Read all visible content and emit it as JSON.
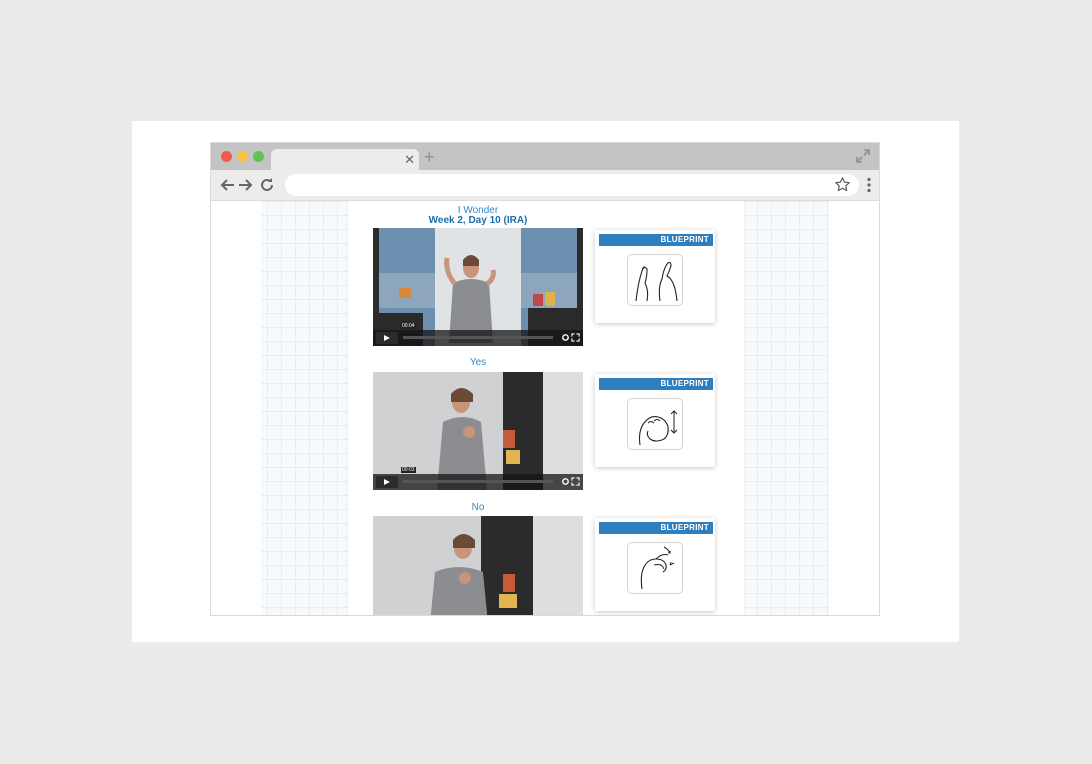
{
  "sections": [
    {
      "title": "I Wonder",
      "subtitle": "Week 2, Day 10 (IRA)",
      "video_time": "00:04",
      "card_brand": "BLUEPRINT"
    },
    {
      "title": "Yes",
      "subtitle": "",
      "video_time": "00:03",
      "card_brand": "BLUEPRINT"
    },
    {
      "title": "No",
      "subtitle": "",
      "video_time": "",
      "card_brand": "BLUEPRINT"
    }
  ],
  "icons": {
    "back": "arrow-left-icon",
    "forward": "arrow-right-icon",
    "reload": "reload-icon",
    "bookmark": "star-icon",
    "menu": "kebab-menu-icon",
    "tab_close": "close-icon",
    "new_tab": "plus-icon",
    "fullscreen": "expand-icon"
  },
  "colors": {
    "link_blue": "#2f8ac9",
    "card_header": "#2f7fbf",
    "close_dot": "#f15a4a",
    "minimize_dot": "#f7c144",
    "maximize_dot": "#5fc456"
  }
}
